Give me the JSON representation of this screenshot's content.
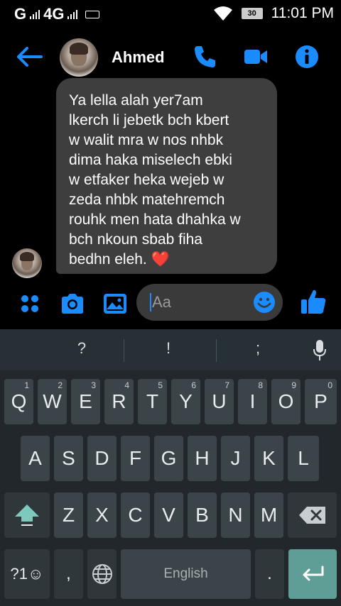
{
  "status_bar": {
    "carrier_g": "G",
    "network": "4G",
    "battery": "30",
    "time": "11:01 PM"
  },
  "header": {
    "contact_name": "Ahmed",
    "icons": [
      "back-arrow-icon",
      "phone-icon",
      "video-camera-icon",
      "info-icon"
    ],
    "accent_color": "#1a8cff"
  },
  "message": {
    "lines": [
      "Ya lella alah yer7am",
      "lkerch li jebetk bch kbert",
      "w walit mra w nos nhbk",
      "dima haka miselech ebki",
      "w etfaker heka wejeb w",
      "zeda nhbk matehremch",
      "rouhk men hata dhahka w",
      "bch nkoun sbab fiha",
      "bedhn eleh."
    ],
    "emoji": "❤️"
  },
  "composer": {
    "placeholder": "Aa",
    "icons": [
      "apps-dots-icon",
      "camera-icon",
      "gallery-icon",
      "emoji-icon",
      "thumbs-up-icon"
    ]
  },
  "keyboard": {
    "suggestions": [
      "?",
      "!",
      ";"
    ],
    "row1": [
      {
        "key": "Q",
        "hint": "1"
      },
      {
        "key": "W",
        "hint": "2"
      },
      {
        "key": "E",
        "hint": "3"
      },
      {
        "key": "R",
        "hint": "4"
      },
      {
        "key": "T",
        "hint": "5"
      },
      {
        "key": "Y",
        "hint": "6"
      },
      {
        "key": "U",
        "hint": "7"
      },
      {
        "key": "I",
        "hint": "8"
      },
      {
        "key": "O",
        "hint": "9"
      },
      {
        "key": "P",
        "hint": "0"
      }
    ],
    "row2": [
      "A",
      "S",
      "D",
      "F",
      "G",
      "H",
      "J",
      "K",
      "L"
    ],
    "row3": [
      "Z",
      "X",
      "C",
      "V",
      "B",
      "N",
      "M"
    ],
    "symbols_key": "?1☺",
    "comma": ",",
    "period": ".",
    "space_label": "English"
  }
}
